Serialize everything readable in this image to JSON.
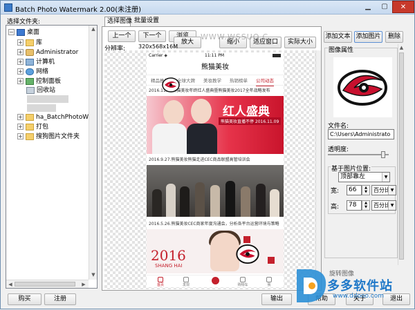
{
  "window": {
    "title": "Batch Photo Watermark 2.00(未注册)"
  },
  "left": {
    "label": "选择文件夹:",
    "tree": [
      {
        "label": "桌面",
        "icon": "desktop-icon",
        "expander": "⊟"
      },
      {
        "label": "库",
        "icon": "library-folder-icon",
        "expander": "⊞"
      },
      {
        "label": "Administrator",
        "icon": "user-folder-icon",
        "expander": "⊞"
      },
      {
        "label": "计算机",
        "icon": "computer-icon",
        "expander": "⊞"
      },
      {
        "label": "网络",
        "icon": "network-icon",
        "expander": "⊞"
      },
      {
        "label": "控制面板",
        "icon": "control-panel-icon",
        "expander": "⊞"
      },
      {
        "label": "回收站",
        "icon": "recycle-bin-icon",
        "expander": ""
      },
      {
        "label": "ha_BatchPhotoWaterMa",
        "icon": "folder-icon",
        "expander": "⊞"
      },
      {
        "label": "打包",
        "icon": "folder-icon",
        "expander": "⊞"
      },
      {
        "label": "搜狗图片文件夹",
        "icon": "folder-icon",
        "expander": "⊞"
      }
    ],
    "buy": "购买",
    "register": "注册"
  },
  "tabs": [
    {
      "label": "选择图像"
    },
    {
      "label": "批量设置"
    }
  ],
  "toolbar": {
    "prev": "上一个",
    "next": "下一个",
    "browse": "浏览",
    "zoom_in": "放大",
    "zoom_out": "缩小",
    "fit": "适应窗口",
    "actual": "实际大小",
    "resolution_label": "分辨率:",
    "resolution_value": "320x568x16M"
  },
  "phone": {
    "carrier": "Carrier ◈",
    "time": "11:11 PM",
    "title": "熊猫美妆",
    "nav": [
      "精品推荐",
      "全球大牌",
      "美妆教学",
      "热销榜单",
      "公司动态"
    ],
    "news": [
      "2016.11.09熊猫美妆年终红人盛典暨熊猫美妆2017全年战略发布",
      "2016.9.27.熊猫美妆熊猫走进CEC商品联盟高管培训会",
      "2016.5.26.熊猫美妆CEC商家年度沟通会，分析各平台运营环境与策略"
    ],
    "banner1_title": "红人盛典",
    "banner1_sub": "熊猫美妆直播不停 2016.11.09",
    "banner3_year": "2016",
    "banner3_city": "SHANG HAI",
    "tabbar": [
      "首页",
      "发现",
      "",
      "购物车",
      "我"
    ],
    "watermark": "WWW.WSSUO.C"
  },
  "right": {
    "add_text": "添加文本",
    "add_image": "添加图片",
    "delete": "删除",
    "group_title": "图像属性",
    "filename_label": "文件名:",
    "filename_value": "C:\\Users\\Administrato",
    "opacity_label": "透明度:",
    "opacity_fraction": 0.95,
    "position_group": "基于图片位置:",
    "position_value": "顶部靠左",
    "width_label": "宽:",
    "width_value": "66",
    "width_unit": "百分比",
    "height_label": "高:",
    "height_value": "78",
    "height_unit": "百分比",
    "rotate_label": "旋转图像"
  },
  "bottom": {
    "output": "输出",
    "help": "帮助",
    "about": "关于",
    "exit": "退出"
  },
  "brand": {
    "name": "多多软件站",
    "url": "www.ddooo.com"
  }
}
